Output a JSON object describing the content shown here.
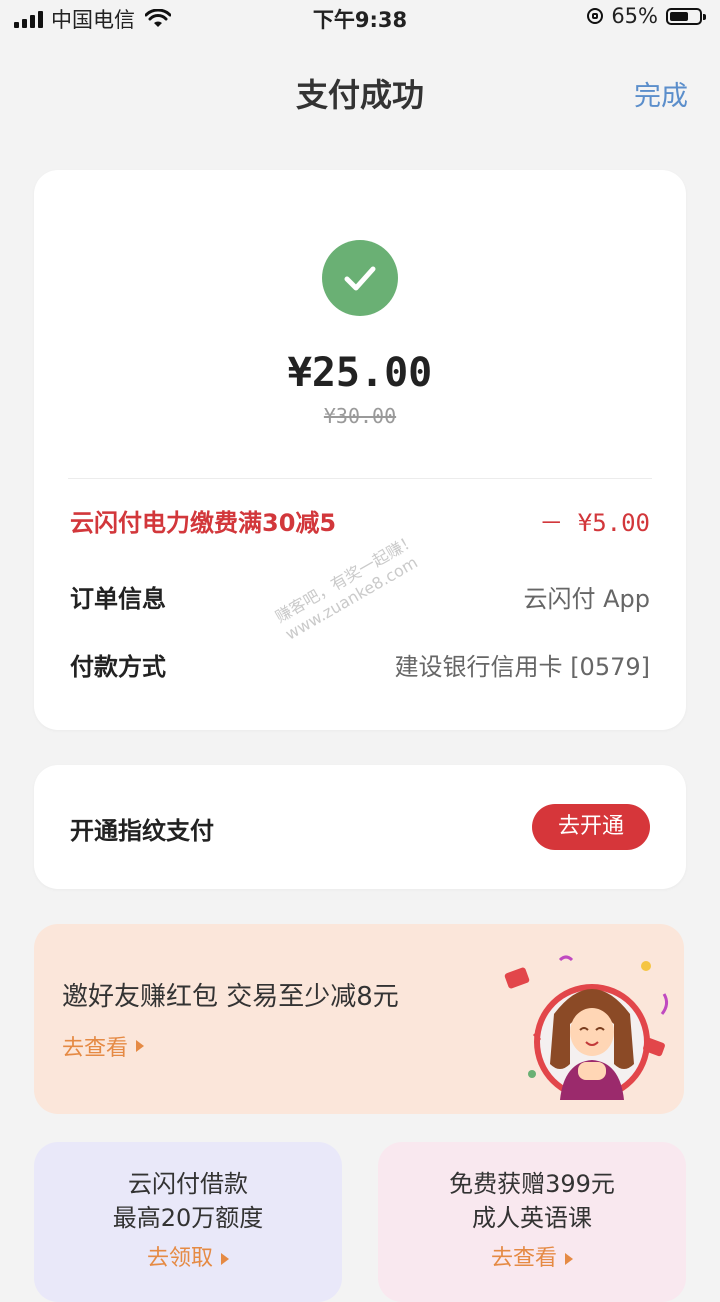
{
  "status_bar": {
    "carrier": "中国电信",
    "time": "下午9:38",
    "battery": "65%",
    "battery_level": 0.65
  },
  "nav": {
    "title": "支付成功",
    "done_label": "完成"
  },
  "payment": {
    "amount": "¥25.00",
    "original_amount": "¥30.00",
    "promo_label": "云闪付电力缴费满30减5",
    "promo_value": "－ ¥5.00",
    "order_info_label": "订单信息",
    "order_info_value": "云闪付 App",
    "payment_method_label": "付款方式",
    "payment_method_value": "建设银行信用卡 [0579]",
    "watermark_line1": "赚客吧，有奖一起赚！",
    "watermark_line2": "www.zuanke8.com"
  },
  "fingerprint": {
    "label": "开通指纹支付",
    "button": "去开通"
  },
  "banner": {
    "title": "邀好友赚红包 交易至少减8元",
    "link": "去查看"
  },
  "tiles": {
    "loan": {
      "line1": "云闪付借款",
      "line2": "最高20万额度",
      "link": "去领取"
    },
    "english": {
      "line1": "免费获赠399元",
      "line2": "成人英语课",
      "link": "去查看"
    }
  },
  "colors": {
    "accent_red": "#d6363a",
    "success_green": "#6ab074",
    "link_blue": "#5b8ecb",
    "link_orange": "#e58a44"
  }
}
